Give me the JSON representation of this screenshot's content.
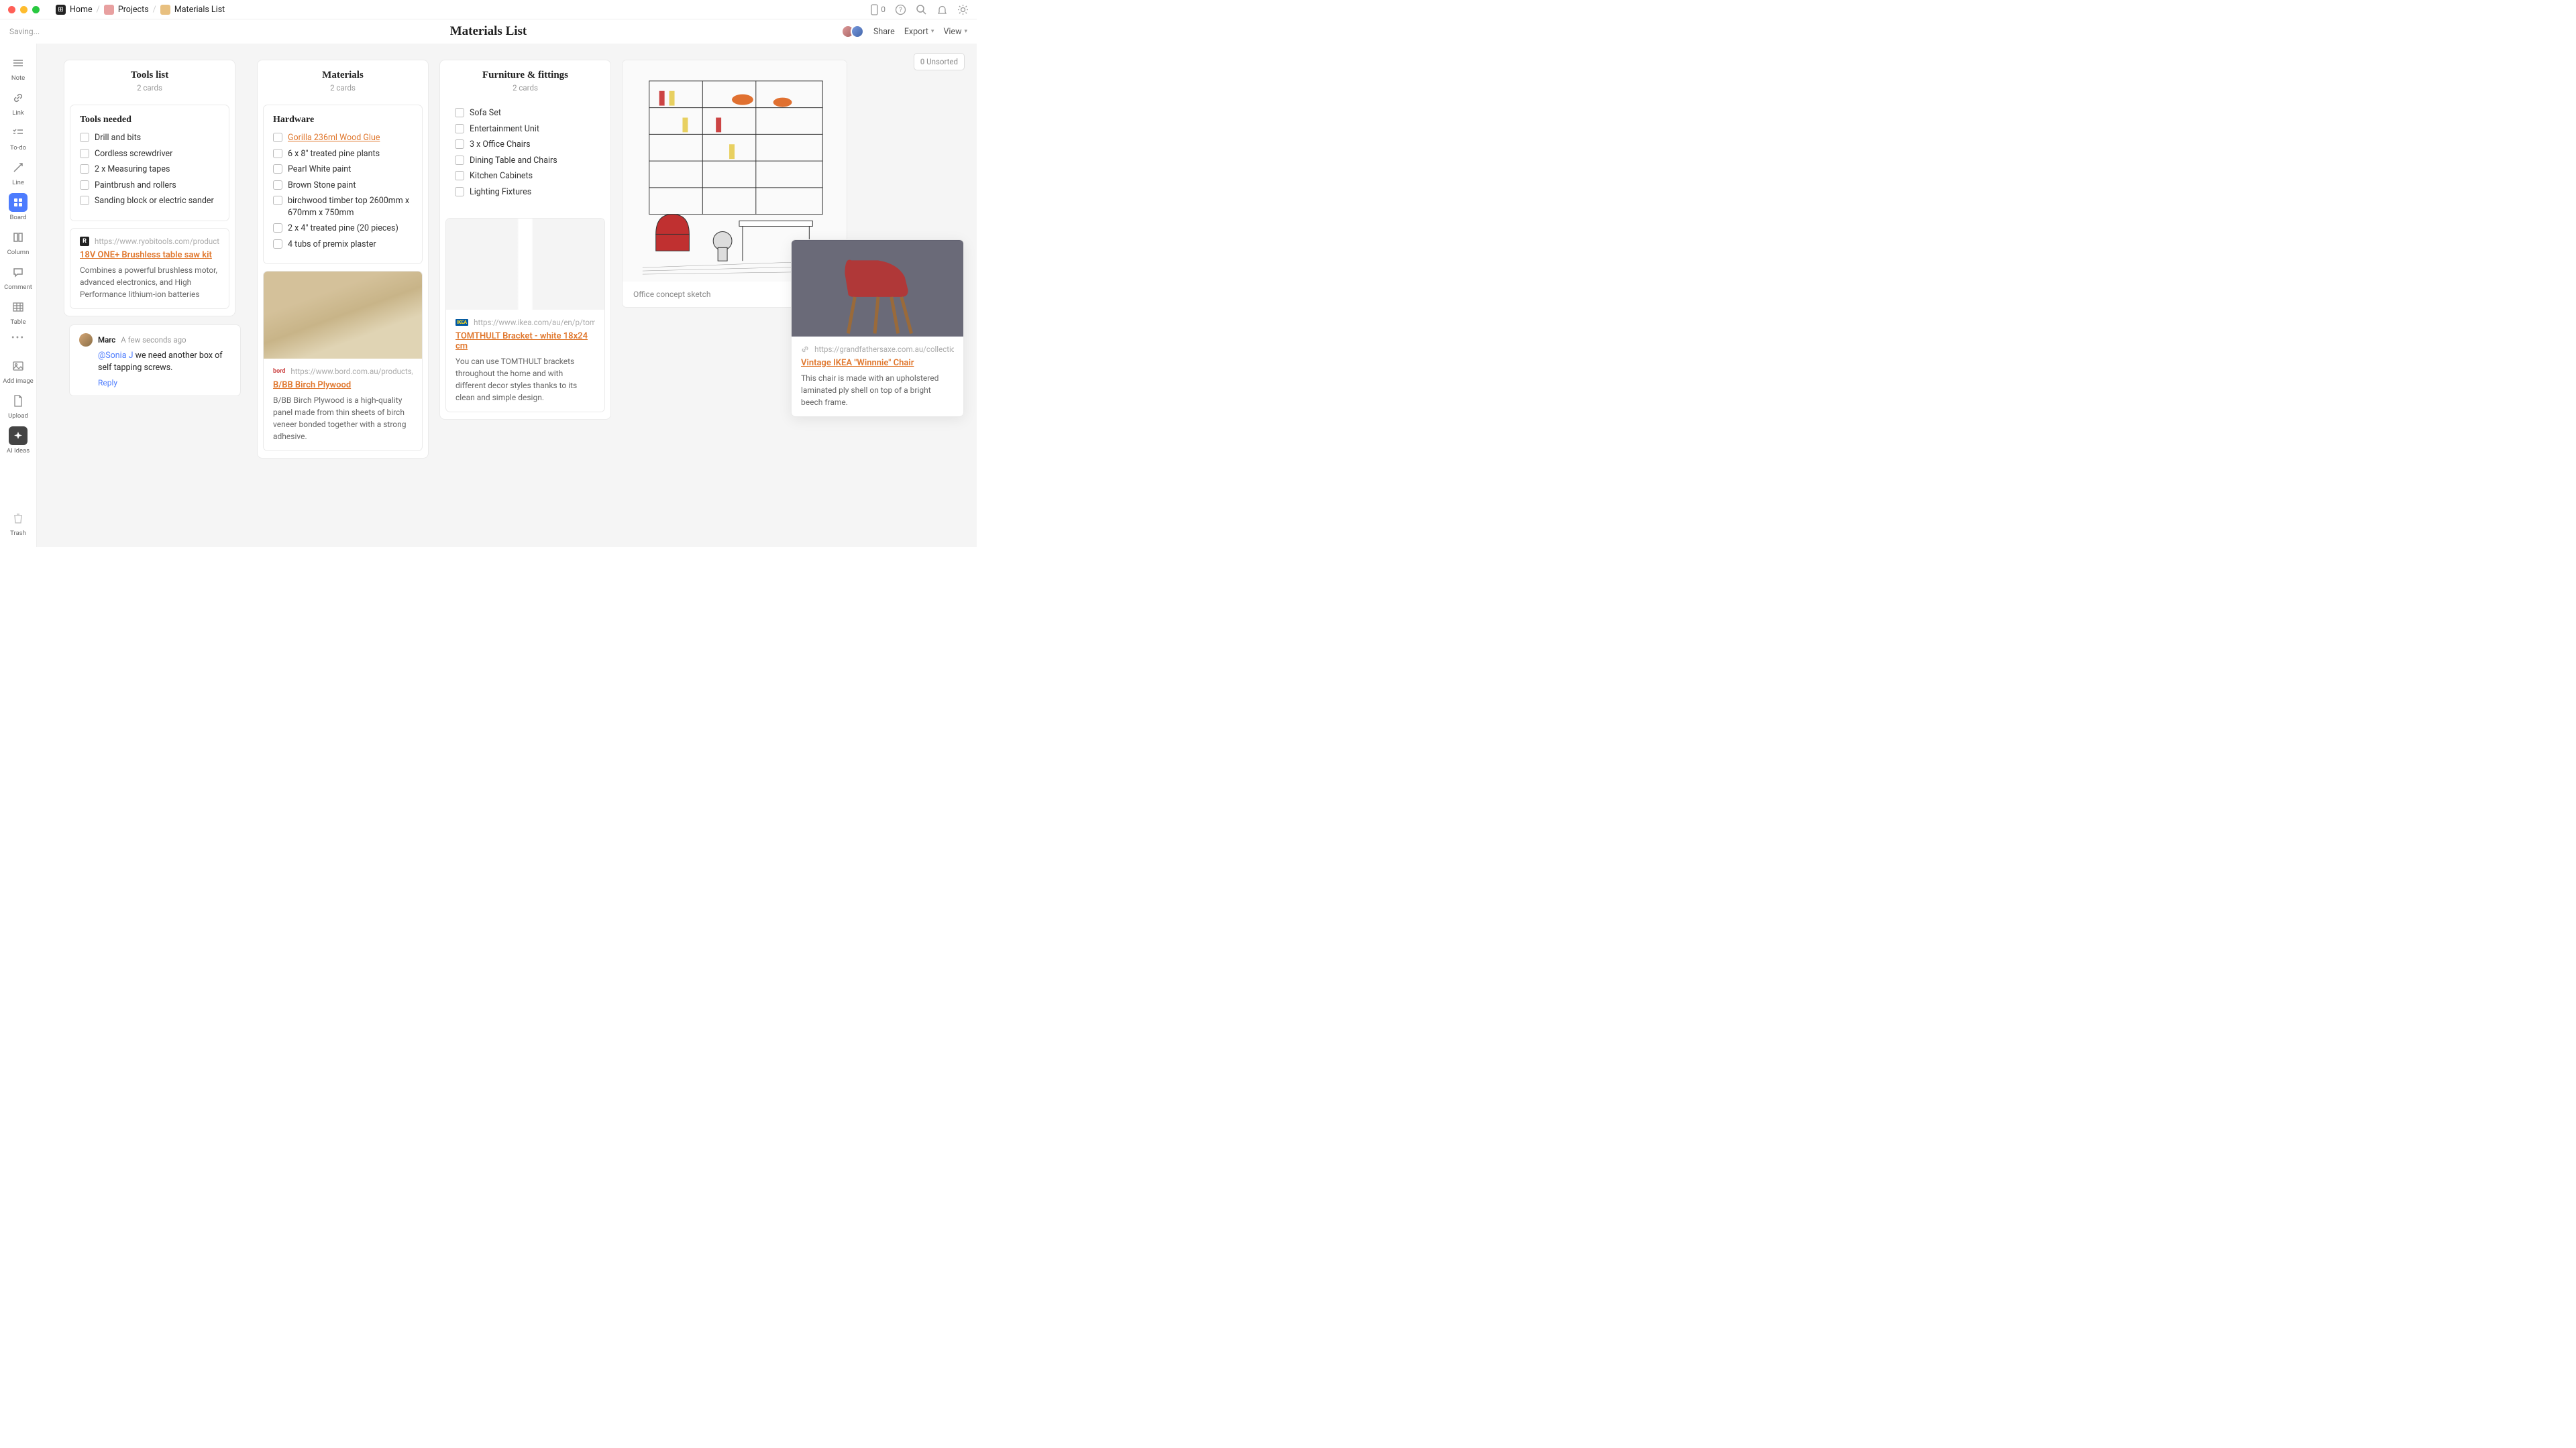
{
  "titlebar": {
    "crumbs": [
      "Home",
      "Projects",
      "Materials List"
    ],
    "mobile_badge": "0"
  },
  "header": {
    "saving": "Saving...",
    "title": "Materials List",
    "share": "Share",
    "export": "Export",
    "view": "View"
  },
  "sidebar": {
    "items": [
      "Note",
      "Link",
      "To-do",
      "Line",
      "Board",
      "Column",
      "Comment",
      "Table"
    ],
    "add_image": "Add image",
    "upload": "Upload",
    "ai_ideas": "AI Ideas",
    "trash": "Trash"
  },
  "unsorted": {
    "count": "0",
    "label": "Unsorted"
  },
  "columns": {
    "tools": {
      "title": "Tools list",
      "sub": "2 cards",
      "card1_title": "Tools needed",
      "items": [
        "Drill and bits",
        "Cordless screwdriver",
        "2 x Measuring tapes",
        "Paintbrush and rollers",
        "Sanding block or electric sander"
      ],
      "link_url": "https://www.ryobitools.com/products/detai",
      "link_title": "18V ONE+ Brushless table saw kit",
      "link_desc": "Combines a powerful brushless motor, advanced electronics, and High Performance lithium-ion batteries"
    },
    "materials": {
      "title": "Materials",
      "sub": "2 cards",
      "card1_title": "Hardware",
      "item0_link": "Gorilla 236ml Wood Glue",
      "items": [
        "6 x 8\" treated pine plants",
        "Pearl White paint",
        "Brown Stone paint",
        "birchwood timber top 2600mm x 670mm x 750mm",
        "2 x 4\" treated pine (20 pieces)",
        "4 tubs of premix plaster"
      ],
      "link_url": "https://www.bord.com.au/products/birch-p",
      "link_title": "B/BB Birch Plywood",
      "link_desc": "B/BB Birch Plywood is a high-quality panel made from thin sheets of birch veneer bonded together with a strong adhesive."
    },
    "furniture": {
      "title": "Furniture & fittings",
      "sub": "2 cards",
      "items": [
        "Sofa Set",
        "Entertainment Unit",
        "3 x Office Chairs",
        "Dining Table and Chairs",
        "Kitchen Cabinets",
        "Lighting Fixtures"
      ],
      "link_url": "https://www.ikea.com/au/en/p/tomthult-br",
      "link_title": "TOMTHULT Bracket - white 18x24 cm",
      "link_desc": "You can use TOMTHULT brackets throughout the home and with different decor styles thanks to its clean and simple design."
    },
    "sketch_caption": "Office concept sketch"
  },
  "comment": {
    "name": "Marc",
    "time": "A few seconds ago",
    "mention": "@Sonia J",
    "body": " we need another box of self tapping screws.",
    "reply": "Reply"
  },
  "float": {
    "url": "https://grandfathersaxe.com.au/collections/ch",
    "title": "Vintage IKEA \"Winnnie\" Chair",
    "desc": "This chair is made with an upholstered laminated ply shell on top of a bright beech frame."
  }
}
